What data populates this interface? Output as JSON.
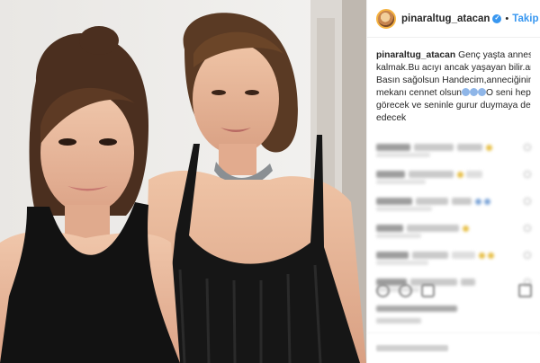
{
  "post": {
    "username": "pinaraltug_atacan",
    "verified_mark": "✓",
    "separator": "•",
    "follow_label": "Takip Et",
    "caption": {
      "username": "pinaraltug_atacan",
      "line1": "Genç yaşta annesiz",
      "line2": "kalmak.Bu acıyı ancak yaşayan bilir.anlar",
      "line3": "Basın sağolsun Handecim,anneciğinin",
      "line4": "mekanı cennet olsun",
      "line4_tail": "O seni hep",
      "line5": "görecek ve seninle gurur duymaya devam",
      "line6": "edecek"
    }
  },
  "icons": {
    "avatar": "avatar-icon",
    "verified": "verified-badge-icon",
    "emoji": "emoji-icon"
  },
  "colors": {
    "follow_blue": "#3897f0",
    "text": "#262626",
    "divider": "#efefef"
  }
}
